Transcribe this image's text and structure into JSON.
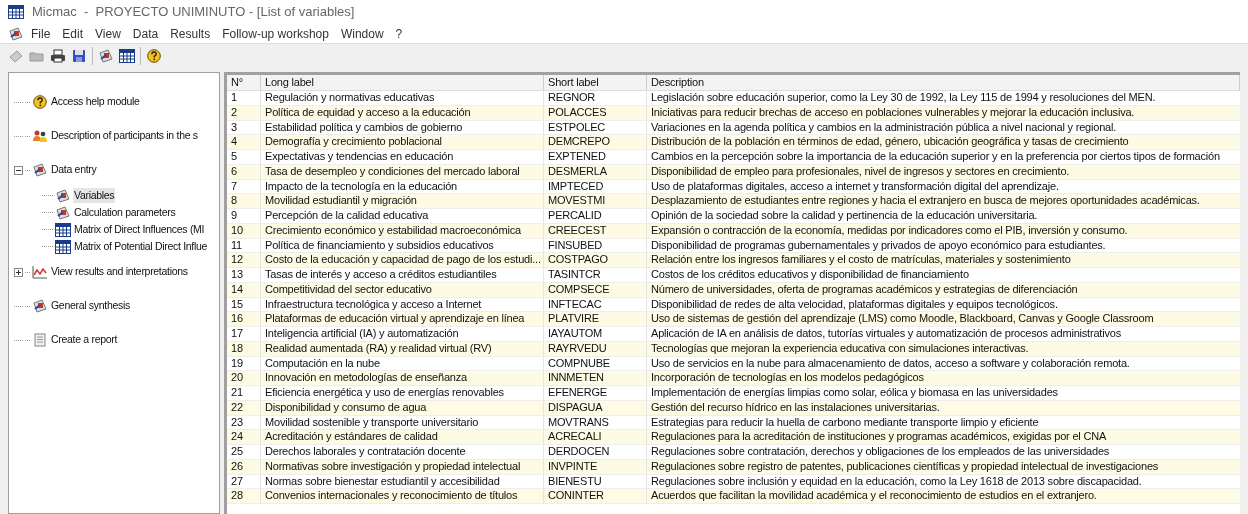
{
  "window": {
    "title": "Micmac  -  PROYECTO UNIMINUTO - [List of variables]"
  },
  "menu": [
    "File",
    "Edit",
    "View",
    "Data",
    "Results",
    "Follow-up workshop",
    "Window",
    "?"
  ],
  "toolbar": [
    {
      "kind": "new"
    },
    {
      "kind": "open"
    },
    {
      "kind": "print"
    },
    {
      "kind": "save"
    },
    {
      "kind": "wizard"
    },
    {
      "kind": "matrix"
    },
    {
      "kind": "help"
    }
  ],
  "tree": [
    {
      "label": "Access help module",
      "kind": "help",
      "selected": false
    },
    {
      "label": "Description of participants in the s",
      "kind": "people",
      "selected": false
    },
    {
      "label": "Data entry",
      "kind": "wizard",
      "selected": false,
      "expanded": true,
      "children": [
        {
          "label": "Variables",
          "kind": "wizard",
          "selected": true
        },
        {
          "label": "Calculation parameters",
          "kind": "wizard",
          "selected": false
        },
        {
          "label": "Matrix of Direct Influences (MI",
          "kind": "matrix",
          "selected": false
        },
        {
          "label": "Matrix of Potential Direct Influe",
          "kind": "matrix",
          "selected": false
        }
      ]
    },
    {
      "label": "View results and interpretations",
      "kind": "chart",
      "selected": false,
      "expanded": false
    },
    {
      "label": "General synthesis",
      "kind": "wizard",
      "selected": false
    },
    {
      "label": "Create a report",
      "kind": "report",
      "selected": false
    }
  ],
  "table": {
    "columns": [
      "N°",
      "Long label",
      "Short label",
      "Description"
    ],
    "rows": [
      [
        "1",
        "Regulación y normativas educativas",
        "REGNOR",
        "Legislación sobre educación superior, como la Ley 30 de 1992, la Ley 115 de 1994 y resoluciones del MEN."
      ],
      [
        "2",
        "Política de equidad y acceso a la educación",
        "POLACCES",
        "Iniciativas para reducir brechas de acceso en poblaciones vulnerables y mejorar la educación inclusiva."
      ],
      [
        "3",
        "Estabilidad política y cambios de gobierno",
        "ESTPOLEC",
        "Variaciones en la agenda política y cambios en la administración pública a nivel nacional y regional."
      ],
      [
        "4",
        "Demografía y crecimiento poblacional",
        "DEMCREPO",
        "Distribución de la población en términos de edad, género, ubicación geográfica y tasas de crecimiento"
      ],
      [
        "5",
        "Expectativas y tendencias en educación",
        "EXPTENED",
        "Cambios en la percepción sobre la importancia de la educación superior y en la preferencia por ciertos tipos de formación"
      ],
      [
        "6",
        "Tasa de desempleo y condiciones del mercado laboral",
        "DESMERLA",
        "Disponibilidad de empleo para profesionales, nivel de ingresos y sectores en crecimiento."
      ],
      [
        "7",
        "Impacto de la tecnología en la educación",
        "IMPTECED",
        "Uso de plataformas digitales, acceso a internet y transformación digital del aprendizaje."
      ],
      [
        "8",
        "Movilidad estudiantil y migración",
        "MOVESTMI",
        "Desplazamiento de estudiantes entre regiones y hacia el extranjero en busca de mejores oportunidades académicas."
      ],
      [
        "9",
        "Percepción de la calidad educativa",
        "PERCALID",
        "Opinión de la sociedad sobre la calidad y pertinencia de la educación universitaria."
      ],
      [
        "10",
        "Crecimiento económico y estabilidad macroeconómica",
        "CREECEST",
        "Expansión o contracción de la economía, medidas por indicadores como el PIB, inversión y consumo."
      ],
      [
        "11",
        "Política de financiamiento y subsidios educativos",
        "FINSUBED",
        "Disponibilidad de programas gubernamentales y privados de apoyo económico para estudiantes."
      ],
      [
        "12",
        "Costo de la educación y capacidad de pago de los estudi...",
        "COSTPAGO",
        "Relación entre los ingresos familiares y el costo de matrículas, materiales y sostenimiento"
      ],
      [
        "13",
        "Tasas de interés y acceso a créditos estudiantiles",
        "TASINTCR",
        "Costos de los créditos educativos y disponibilidad de financiamiento"
      ],
      [
        "14",
        "Competitividad del sector educativo",
        "COMPSECE",
        "Número de universidades, oferta de programas académicos y estrategias de diferenciación"
      ],
      [
        "15",
        "Infraestructura tecnológica y acceso a Internet",
        "INFTECAC",
        "Disponibilidad de redes de alta velocidad, plataformas digitales y equipos tecnológicos."
      ],
      [
        "16",
        "Plataformas de educación virtual y aprendizaje en línea",
        "PLATVIRE",
        "Uso de sistemas de gestión del aprendizaje (LMS) como Moodle, Blackboard, Canvas y Google Classroom"
      ],
      [
        "17",
        "Inteligencia artificial (IA) y automatización",
        "IAYAUTOM",
        "Aplicación de IA en análisis de datos, tutorías virtuales y automatización de procesos administrativos"
      ],
      [
        "18",
        "Realidad aumentada (RA) y realidad virtual (RV)",
        "RAYRVEDU",
        "Tecnologías que mejoran la experiencia educativa con simulaciones interactivas."
      ],
      [
        "19",
        "Computación en la nube",
        "COMPNUBE",
        "Uso de servicios en la nube para almacenamiento de datos, acceso a software y colaboración remota."
      ],
      [
        "20",
        "Innovación en metodologías de enseñanza",
        "INNMETEN",
        "Incorporación de tecnologías en los modelos pedagógicos"
      ],
      [
        "21",
        "Eficiencia energética y uso de energías renovables",
        "EFENERGE",
        "Implementación de energías limpias como solar, eólica y biomasa en las universidades"
      ],
      [
        "22",
        "Disponibilidad y consumo de agua",
        "DISPAGUA",
        "Gestión del recurso hídrico en las instalaciones universitarias."
      ],
      [
        "23",
        "Movilidad sostenible y transporte universitario",
        "MOVTRANS",
        "Estrategias para reducir la huella de carbono mediante transporte limpio y eficiente"
      ],
      [
        "24",
        "Acreditación y estándares de calidad",
        "ACRECALI",
        "Regulaciones para la acreditación de instituciones y programas académicos, exigidas por el CNA"
      ],
      [
        "25",
        "Derechos laborales y contratación docente",
        "DERDOCEN",
        "Regulaciones sobre contratación, derechos y obligaciones de los empleados de las universidades"
      ],
      [
        "26",
        "Normativas sobre investigación y propiedad intelectual",
        "INVPINTE",
        "Regulaciones sobre registro de patentes, publicaciones científicas y propiedad intelectual de investigaciones"
      ],
      [
        "27",
        "Normas sobre bienestar estudiantil y accesibilidad",
        "BIENESTU",
        "Regulaciones sobre inclusión y equidad en la educación, como la Ley 1618 de 2013 sobre discapacidad."
      ],
      [
        "28",
        "Convenios internacionales y reconocimiento de títulos",
        "CONINTER",
        "Acuerdos que facilitan la movilidad académica y el reconocimiento de estudios en el extranjero."
      ]
    ]
  }
}
